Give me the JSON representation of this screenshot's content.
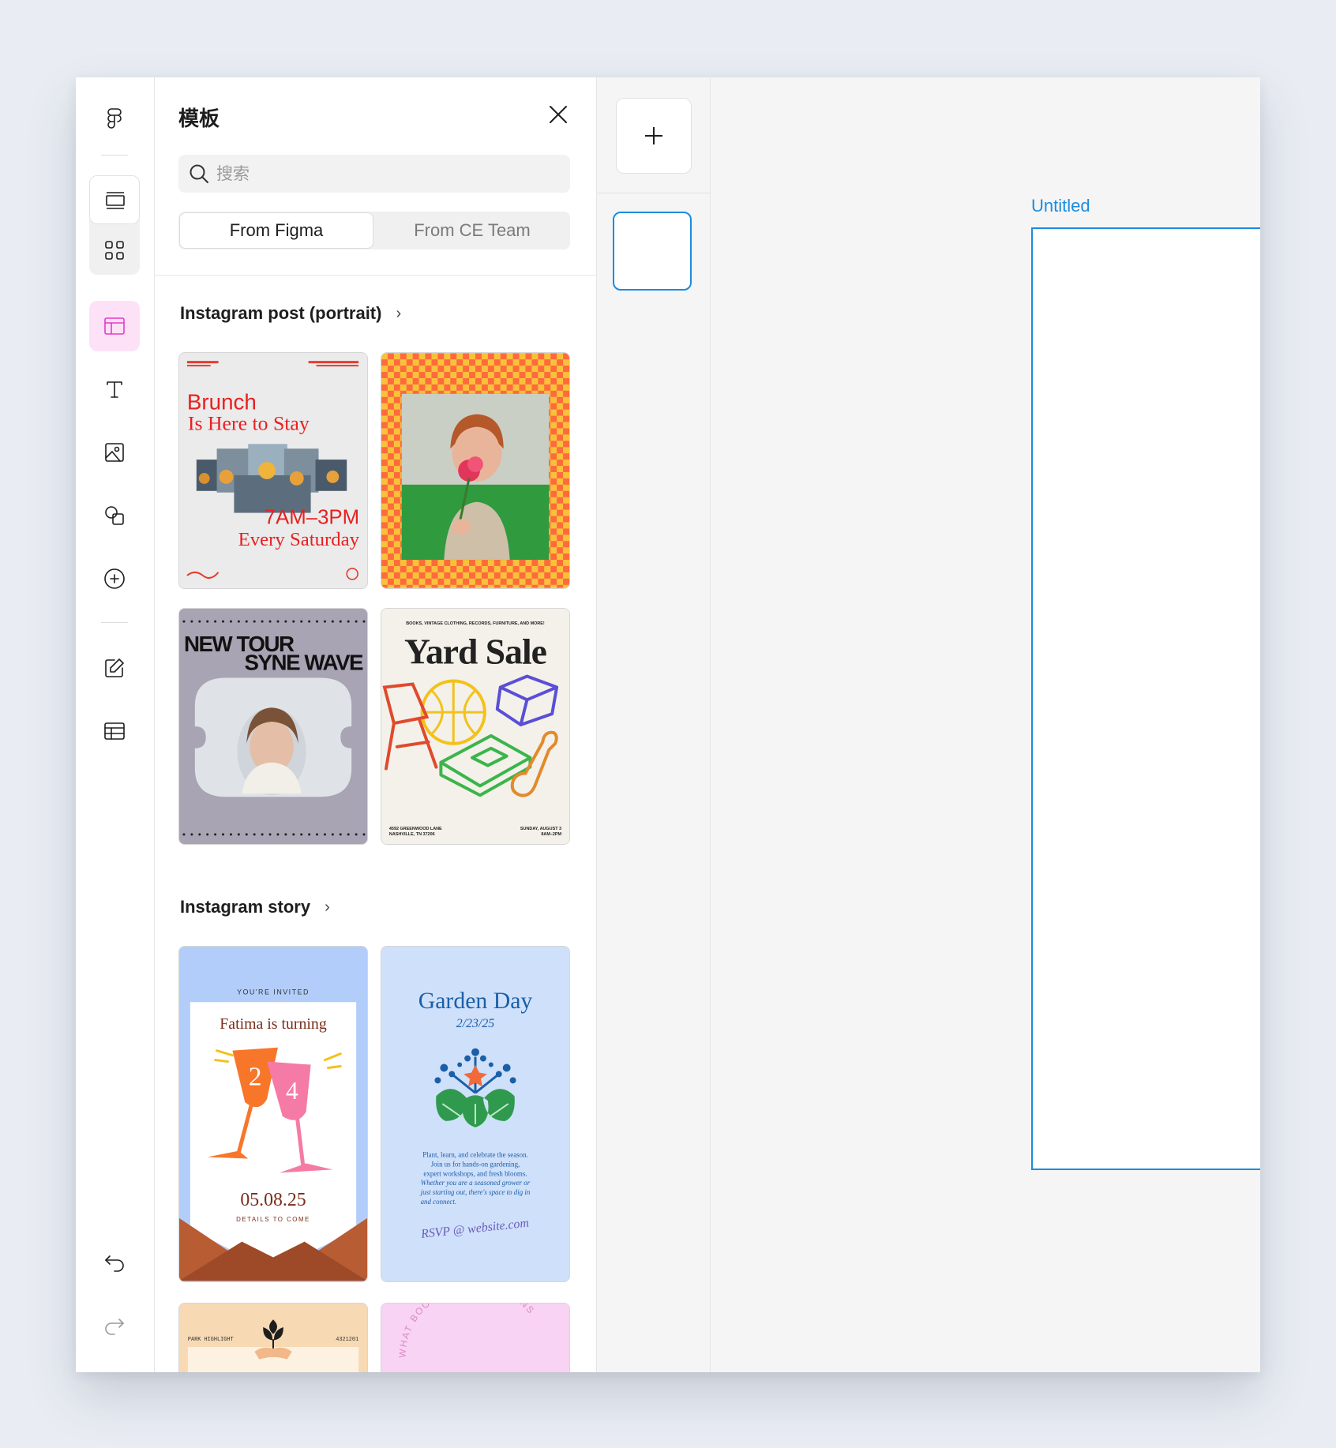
{
  "panel": {
    "title": "模板",
    "search_placeholder": "搜索",
    "tabs": [
      "From Figma",
      "From CE Team"
    ]
  },
  "sections": [
    {
      "title": "Instagram post (portrait)",
      "cards": [
        {
          "name": "brunch-template",
          "lines": [
            "Brunch",
            "Is Here to Stay",
            "7AM–3PM",
            "Every Saturday"
          ]
        },
        {
          "name": "checker-portrait-template",
          "lines": []
        },
        {
          "name": "tour-template",
          "lines": [
            "NEW TOUR",
            "SYNE WAVE"
          ]
        },
        {
          "name": "yard-sale-template",
          "lines": [
            "BOOKS, VINTAGE CLOTHING, RECORDS, FURNITURE, AND MORE!",
            "Yard Sale",
            "4592 GREENWOOD LANE",
            "NASHVILLE, TN 37206",
            "SUNDAY, AUGUST 3",
            "8AM–2PM"
          ]
        }
      ]
    },
    {
      "title": "Instagram story",
      "cards": [
        {
          "name": "invite-template",
          "lines": [
            "YOU'RE INVITED",
            "Fatima is turning",
            "2",
            "4",
            "05.08.25",
            "DETAILS TO COME"
          ]
        },
        {
          "name": "garden-day-template",
          "lines": [
            "Garden Day",
            "2/23/25",
            "Plant, learn, and celebrate the season.",
            "Join us for hands-on gardening,",
            "expert workshops, and fresh blooms.",
            "Whether you are a seasoned grower or",
            "just starting out, there's space to dig in",
            "and connect.",
            "RSVP @ website.com"
          ]
        },
        {
          "name": "park-highlight-template",
          "lines": [
            "PARK HIGHLIGHT",
            "4321201"
          ]
        },
        {
          "name": "books-movies-template",
          "lines": [
            "WHAT BOOKS OR MOVIES INS"
          ]
        }
      ]
    }
  ],
  "canvas": {
    "frame_label": "Untitled"
  },
  "colors": {
    "accent": "#1b8ce0",
    "templates_active": "#e33ac7",
    "templates_active_bg": "#fde2f7"
  }
}
